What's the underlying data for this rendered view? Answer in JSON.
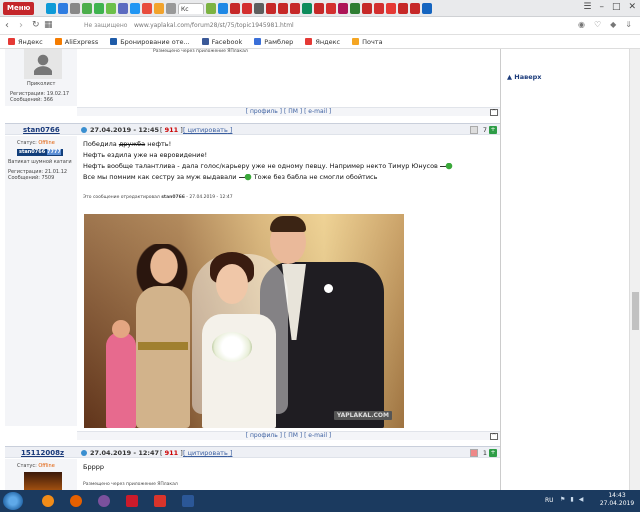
{
  "browser": {
    "menu_label": "Меню",
    "active_tab_label": "Кс",
    "tabs": [
      {
        "color": "#0e9ad7"
      },
      {
        "color": "#2f7de1"
      },
      {
        "color": "#888888"
      },
      {
        "color": "#4cae4c"
      },
      {
        "color": "#3fb34f"
      },
      {
        "color": "#6cc04a"
      },
      {
        "color": "#5c6bc0"
      },
      {
        "color": "#2196f3"
      },
      {
        "color": "#e84c3d"
      },
      {
        "color": "#f2a32c"
      },
      {
        "color": "#999999"
      },
      {
        "color": "#7cb342"
      },
      {
        "color": "#1e88e5"
      },
      {
        "color": "#c62828"
      },
      {
        "color": "#d32f2f"
      },
      {
        "color": "#5e5e5e"
      },
      {
        "color": "#c62828"
      },
      {
        "color": "#c62828"
      },
      {
        "color": "#c62828"
      },
      {
        "color": "#0d8c5c"
      },
      {
        "color": "#c62828"
      },
      {
        "color": "#d32f2f"
      },
      {
        "color": "#ad1457"
      },
      {
        "color": "#2e7d32"
      },
      {
        "color": "#c62828"
      },
      {
        "color": "#d32f2f"
      },
      {
        "color": "#e53935"
      },
      {
        "color": "#c62828"
      },
      {
        "color": "#c62828"
      },
      {
        "color": "#1565c0"
      }
    ],
    "security_label": "Не защищено",
    "url": "www.yaplakal.com/forum28/st/75/topic1945981.html",
    "bookmarks": [
      {
        "label": "Яндекс",
        "color": "#e53935"
      },
      {
        "label": "AliExpress",
        "color": "#f57c00"
      },
      {
        "label": "Бронирование оте...",
        "color": "#1e5ba8"
      },
      {
        "label": "Facebook",
        "color": "#3b5998"
      },
      {
        "label": "Рамблер",
        "color": "#3a6fd8"
      },
      {
        "label": "Яндекс",
        "color": "#e53935"
      },
      {
        "label": "Почта",
        "color": "#f5a623"
      }
    ]
  },
  "forum": {
    "top_note": "Размещено через приложение ЯПлакал",
    "back_to_top": "Наверх",
    "actions": {
      "profile": "[ профиль ]",
      "pm": "[ ПМ ]",
      "email": "[ e-mail ]",
      "up": "[^]"
    },
    "user1": {
      "rank": "Приколист",
      "registration": "Регистрация: 19.02.17",
      "messages": "Сообщений: 366"
    },
    "post2": {
      "username": "stan0766",
      "date": "27.04.2019 - 12:45",
      "rating": "911",
      "quote_label": "цитировать",
      "votes": "7",
      "status_label": "Статус:",
      "status_value": "Offline",
      "rank_name": "stan0766",
      "rank_tag": "7777",
      "rank_title": "Ватикат шумной катаги",
      "registration": "Регистрация: 21.01.12",
      "messages": "Сообщений: 7509",
      "line1_pre": "Победила",
      "line1_strike": "дружба",
      "line1_post": "нефть!",
      "line2": "Нефть ездила уже на евровидение!",
      "line3": "Нефть вообще талантлива - дала голос/карьеру уже не одному певцу. Например некто Тимур Юнусов",
      "line4_pre": "Все мы помним как сестру за муж выдавали",
      "line4_post": "Тоже без бабла не смогли обойтись",
      "edited_pre": "Это сообщение отредактировал",
      "edited_user": "stan0766",
      "edited_date": "- 27.04.2019 - 12:47",
      "watermark": "YAPLAKAL.COM"
    },
    "post3": {
      "username": "15112008z",
      "date": "27.04.2019 - 12:47",
      "rating": "911",
      "quote_label": "цитировать",
      "votes": "1",
      "status_label": "Статус:",
      "status_value": "Offline",
      "text": "Брррр",
      "via_app": "Размещено через приложение ЯПлакал"
    }
  },
  "taskbar": {
    "apps": [
      {
        "name": "vlc",
        "color": "#f28c18"
      },
      {
        "name": "firefox",
        "color": "#e66000"
      },
      {
        "name": "viber",
        "color": "#7b519d"
      },
      {
        "name": "opera",
        "color": "#cc1b2b"
      },
      {
        "name": "app",
        "color": "#d9342b"
      },
      {
        "name": "word",
        "color": "#2b5797"
      }
    ],
    "lang": "RU",
    "time": "14:43",
    "date": "27.04.2019"
  }
}
